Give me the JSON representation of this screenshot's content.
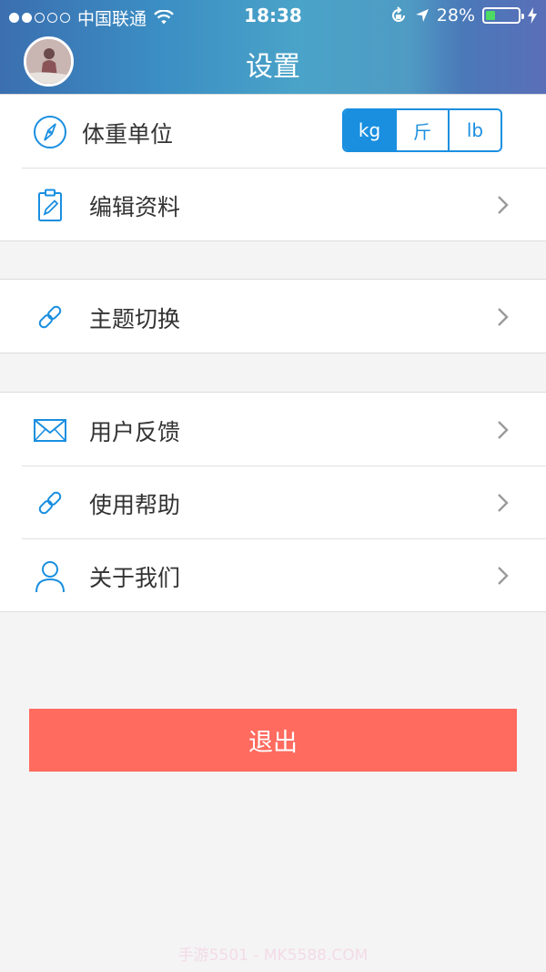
{
  "status_bar": {
    "carrier": "中国联通",
    "time": "18:38",
    "battery_percent": "28%",
    "battery_level": 0.28,
    "signal_filled": 2,
    "signal_total": 5
  },
  "header": {
    "title": "设置"
  },
  "weight_unit": {
    "label": "体重单位",
    "options": [
      "kg",
      "斤",
      "lb"
    ],
    "selected": "kg"
  },
  "menu": {
    "edit_profile": "编辑资料",
    "theme_switch": "主题切换",
    "feedback": "用户反馈",
    "help": "使用帮助",
    "about_us": "关于我们"
  },
  "logout_label": "退出",
  "watermark": "手游5501 - MK5588.COM",
  "colors": {
    "accent": "#1a8fe0",
    "logout": "#ff6b5f",
    "battery": "#4cd964"
  }
}
